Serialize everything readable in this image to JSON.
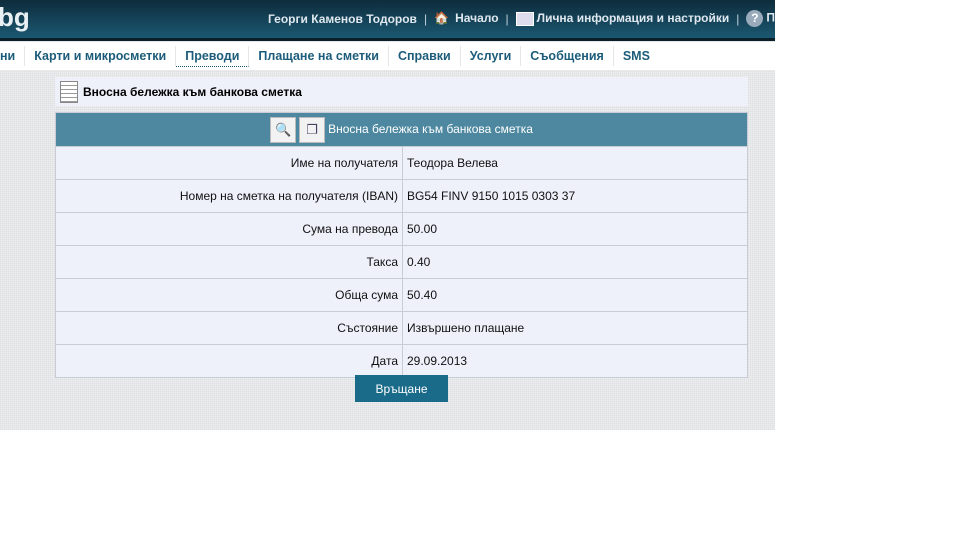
{
  "header": {
    "logo": "bg",
    "user": "Георги Каменов Тодоров",
    "home": "Начало",
    "settings": "Лична информация и настройки",
    "help": "П"
  },
  "nav": [
    "ни",
    "Карти и микросметки",
    "Преводи",
    "Плащане на сметки",
    "Справки",
    "Услуги",
    "Съобщения",
    "SMS"
  ],
  "title": "Вносна бележка към банкова сметка",
  "table": {
    "heading": "Вносна бележка към банкова сметка",
    "rows": [
      {
        "label": "Име на получателя",
        "value": "Теодора Велева"
      },
      {
        "label": "Номер на сметка на получателя (IBAN)",
        "value": "BG54 FINV 9150 1015 0303 37"
      },
      {
        "label": "Сума на превода",
        "value": "50.00"
      },
      {
        "label": "Такса",
        "value": "0.40"
      },
      {
        "label": "Обща сума",
        "value": "50.40"
      },
      {
        "label": "Състояние",
        "value": "Извършено плащане"
      },
      {
        "label": "Дата",
        "value": "29.09.2013"
      }
    ]
  },
  "back_label": "Връщане"
}
